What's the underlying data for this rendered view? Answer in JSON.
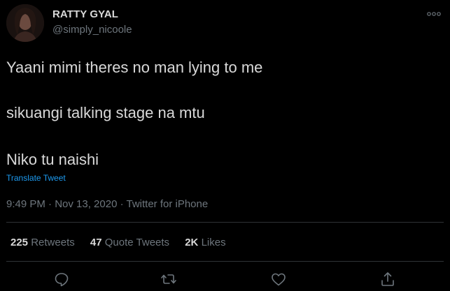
{
  "tweet": {
    "display_name": "RATTY GYAL",
    "handle": "@simply_nicoole",
    "lines": [
      "Yaani mimi theres no man lying to me",
      "sikuangi talking stage na mtu",
      "Niko tu naishi"
    ],
    "translate_label": "Translate Tweet",
    "meta": "9:49 PM · Nov 13, 2020 · Twitter for iPhone",
    "stats": {
      "retweets_count": "225",
      "retweets_label": "Retweets",
      "quotes_count": "47",
      "quotes_label": "Quote Tweets",
      "likes_count": "2K",
      "likes_label": "Likes"
    }
  },
  "icons": {
    "more": "more-options-icon",
    "reply": "reply-icon",
    "retweet": "retweet-icon",
    "like": "heart-icon",
    "share": "share-icon"
  },
  "colors": {
    "background": "#000000",
    "text": "#d9d9d9",
    "secondary": "#6e767d",
    "link": "#1d9bf0",
    "divider": "#2f3336"
  }
}
